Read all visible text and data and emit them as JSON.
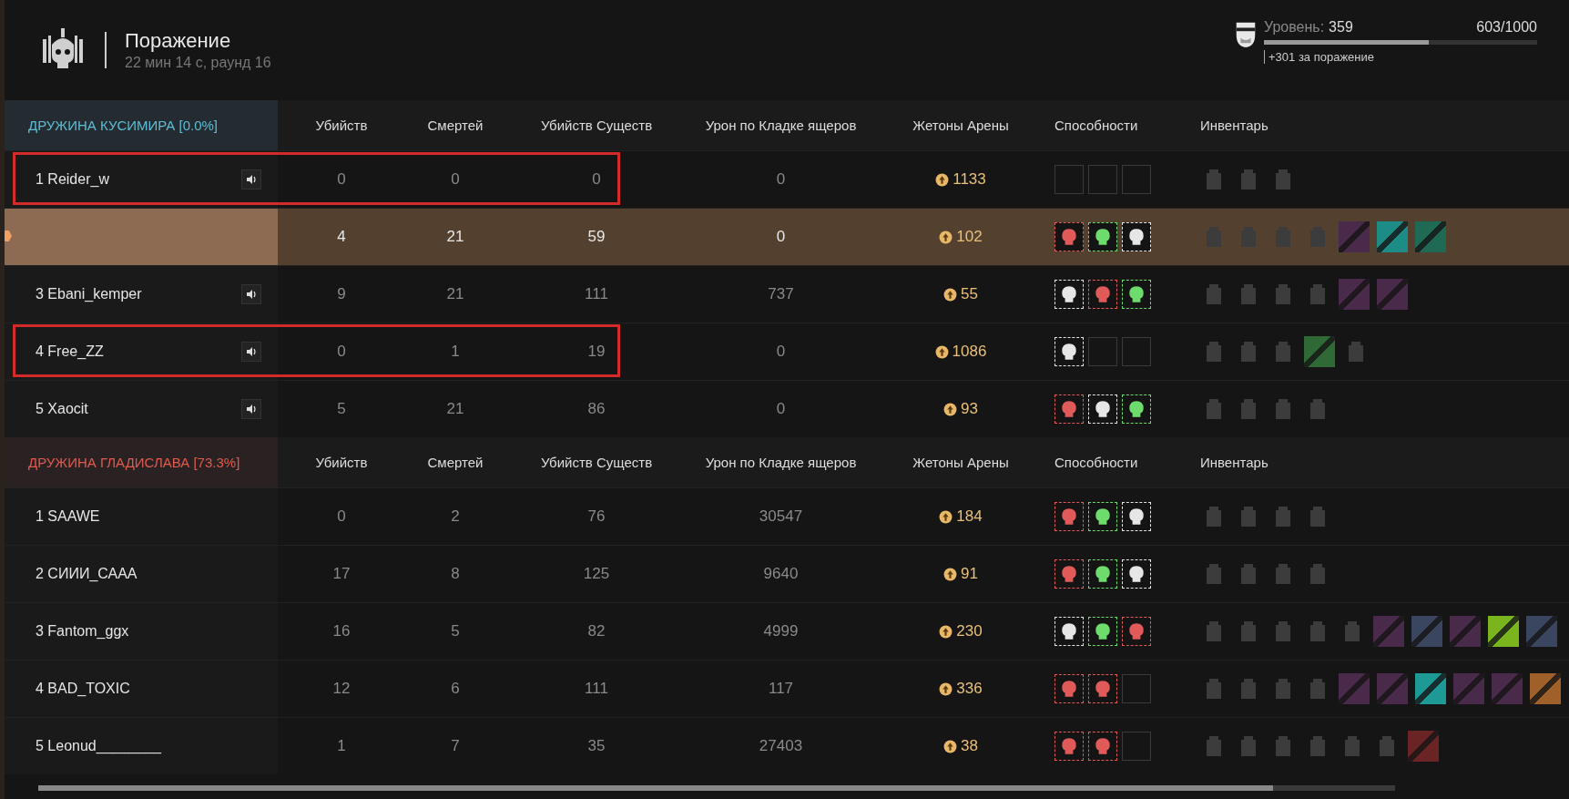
{
  "header": {
    "title": "Поражение",
    "subtitle": "22 мин 14 с, раунд 16"
  },
  "level": {
    "label": "Уровень:",
    "value": "359",
    "progress_text": "603/1000",
    "level": 0.603,
    "reward": "+301 за поражение"
  },
  "teams": [
    {
      "name": "ДРУЖИНА КУСИМИРА [0.0%]",
      "color": "#5bbdd6",
      "columns": [
        "Убийств",
        "Смертей",
        "Убийств Существ",
        "Урон по Кладке ящеров",
        "Жетоны Арены",
        "Способности",
        "Инвентарь"
      ],
      "rows": [
        {
          "rank": "1",
          "name": "Reider_w",
          "voice": true,
          "selected": false,
          "highlighted": true,
          "kills": "0",
          "deaths": "0",
          "creatures": "0",
          "damage": "0",
          "tokens": "1133",
          "abilities": [
            {
              "kind": "empty"
            },
            {
              "kind": "empty"
            },
            {
              "kind": "empty"
            }
          ],
          "inventory": [
            {
              "kind": "gear"
            },
            {
              "kind": "gear"
            },
            {
              "kind": "gear"
            }
          ]
        },
        {
          "selected": true,
          "highlighted": false,
          "kills": "4",
          "deaths": "21",
          "creatures": "59",
          "damage": "0",
          "tokens": "102",
          "abilities": [
            {
              "kind": "skill",
              "color": "#e05a5a"
            },
            {
              "kind": "skill",
              "color": "#6ddc6d"
            },
            {
              "kind": "skill",
              "color": "#e6e6e6"
            }
          ],
          "inventory": [
            {
              "kind": "gear"
            },
            {
              "kind": "gear"
            },
            {
              "kind": "gear"
            },
            {
              "kind": "gear"
            },
            {
              "kind": "tile",
              "color": "#4a2a4a"
            },
            {
              "kind": "tile",
              "color": "#1e8c86"
            },
            {
              "kind": "tile",
              "color": "#1f6a55"
            }
          ]
        },
        {
          "rank": "3",
          "name": "Ebani_kemper",
          "voice": true,
          "selected": false,
          "highlighted": false,
          "kills": "9",
          "deaths": "21",
          "creatures": "111",
          "damage": "737",
          "tokens": "55",
          "abilities": [
            {
              "kind": "skill",
              "color": "#e6e6e6"
            },
            {
              "kind": "skill",
              "color": "#e05a5a"
            },
            {
              "kind": "skill",
              "color": "#6ddc6d"
            }
          ],
          "inventory": [
            {
              "kind": "gear"
            },
            {
              "kind": "gear"
            },
            {
              "kind": "gear"
            },
            {
              "kind": "gear"
            },
            {
              "kind": "tile",
              "color": "#4a2a4a"
            },
            {
              "kind": "tile",
              "color": "#4a2a4a"
            }
          ]
        },
        {
          "rank": "4",
          "name": "Free_ZZ",
          "voice": true,
          "selected": false,
          "highlighted": true,
          "kills": "0",
          "deaths": "1",
          "creatures": "19",
          "damage": "0",
          "tokens": "1086",
          "abilities": [
            {
              "kind": "skill",
              "color": "#e6e6e6"
            },
            {
              "kind": "empty"
            },
            {
              "kind": "empty"
            }
          ],
          "inventory": [
            {
              "kind": "gear"
            },
            {
              "kind": "gear"
            },
            {
              "kind": "gear"
            },
            {
              "kind": "tile",
              "color": "#2f6a36"
            },
            {
              "kind": "gear"
            }
          ]
        },
        {
          "rank": "5",
          "name": "Xaocit",
          "voice": true,
          "selected": false,
          "highlighted": false,
          "kills": "5",
          "deaths": "21",
          "creatures": "86",
          "damage": "0",
          "tokens": "93",
          "abilities": [
            {
              "kind": "skill",
              "color": "#e05a5a"
            },
            {
              "kind": "skill",
              "color": "#e6e6e6"
            },
            {
              "kind": "skill",
              "color": "#6ddc6d"
            }
          ],
          "inventory": [
            {
              "kind": "gear"
            },
            {
              "kind": "gear"
            },
            {
              "kind": "gear"
            },
            {
              "kind": "gear"
            }
          ]
        }
      ]
    },
    {
      "name": "ДРУЖИНА ГЛАДИСЛАВА [73.3%]",
      "color": "#e05a4f",
      "columns": [
        "Убийств",
        "Смертей",
        "Убийств Существ",
        "Урон по Кладке ящеров",
        "Жетоны Арены",
        "Способности",
        "Инвентарь"
      ],
      "rows": [
        {
          "rank": "1",
          "name": "SAAWE",
          "voice": false,
          "selected": false,
          "highlighted": false,
          "kills": "0",
          "deaths": "2",
          "creatures": "76",
          "damage": "30547",
          "tokens": "184",
          "abilities": [
            {
              "kind": "skill",
              "color": "#e05a5a"
            },
            {
              "kind": "skill",
              "color": "#6ddc6d"
            },
            {
              "kind": "skill",
              "color": "#e6e6e6"
            }
          ],
          "inventory": [
            {
              "kind": "gear"
            },
            {
              "kind": "gear"
            },
            {
              "kind": "gear"
            },
            {
              "kind": "gear"
            }
          ]
        },
        {
          "rank": "2",
          "name": "СИИИ_САAA",
          "voice": false,
          "selected": false,
          "highlighted": false,
          "kills": "17",
          "deaths": "8",
          "creatures": "125",
          "damage": "9640",
          "tokens": "91",
          "abilities": [
            {
              "kind": "skill",
              "color": "#e05a5a"
            },
            {
              "kind": "skill",
              "color": "#6ddc6d"
            },
            {
              "kind": "skill",
              "color": "#e6e6e6"
            }
          ],
          "inventory": [
            {
              "kind": "gear"
            },
            {
              "kind": "gear"
            },
            {
              "kind": "gear"
            },
            {
              "kind": "gear"
            }
          ]
        },
        {
          "rank": "3",
          "name": "Fantom_ggx",
          "voice": false,
          "selected": false,
          "highlighted": false,
          "kills": "16",
          "deaths": "5",
          "creatures": "82",
          "damage": "4999",
          "tokens": "230",
          "abilities": [
            {
              "kind": "skill",
              "color": "#e6e6e6"
            },
            {
              "kind": "skill",
              "color": "#6ddc6d"
            },
            {
              "kind": "skill",
              "color": "#e05a5a"
            }
          ],
          "inventory": [
            {
              "kind": "gear"
            },
            {
              "kind": "gear"
            },
            {
              "kind": "gear"
            },
            {
              "kind": "gear"
            },
            {
              "kind": "gear"
            },
            {
              "kind": "tile",
              "color": "#4a2a4a"
            },
            {
              "kind": "tile",
              "color": "#3a4660"
            },
            {
              "kind": "tile",
              "color": "#4a2a4a"
            },
            {
              "kind": "tile",
              "color": "#7ab51e"
            },
            {
              "kind": "tile",
              "color": "#3a4660"
            }
          ]
        },
        {
          "rank": "4",
          "name": "BAD_TOXIC",
          "voice": false,
          "selected": false,
          "highlighted": false,
          "kills": "12",
          "deaths": "6",
          "creatures": "111",
          "damage": "117",
          "tokens": "336",
          "abilities": [
            {
              "kind": "skill",
              "color": "#e05a5a"
            },
            {
              "kind": "skill",
              "color": "#e05a5a"
            },
            {
              "kind": "empty"
            }
          ],
          "inventory": [
            {
              "kind": "gear"
            },
            {
              "kind": "gear"
            },
            {
              "kind": "gear"
            },
            {
              "kind": "gear"
            },
            {
              "kind": "tile",
              "color": "#4a2a4a"
            },
            {
              "kind": "tile",
              "color": "#4a2a4a"
            },
            {
              "kind": "tile",
              "color": "#1e9a96"
            },
            {
              "kind": "tile",
              "color": "#4a2a4a"
            },
            {
              "kind": "tile",
              "color": "#4a2a4a"
            },
            {
              "kind": "tile",
              "color": "#a0602a"
            }
          ]
        },
        {
          "rank": "5",
          "name": "Leonud________",
          "voice": false,
          "selected": false,
          "highlighted": false,
          "kills": "1",
          "deaths": "7",
          "creatures": "35",
          "damage": "27403",
          "tokens": "38",
          "abilities": [
            {
              "kind": "skill",
              "color": "#e05a5a"
            },
            {
              "kind": "skill",
              "color": "#e05a5a"
            },
            {
              "kind": "empty"
            }
          ],
          "inventory": [
            {
              "kind": "gear"
            },
            {
              "kind": "gear"
            },
            {
              "kind": "gear"
            },
            {
              "kind": "gear"
            },
            {
              "kind": "gear"
            },
            {
              "kind": "gear"
            },
            {
              "kind": "tile",
              "color": "#6a2424"
            }
          ]
        }
      ]
    }
  ]
}
